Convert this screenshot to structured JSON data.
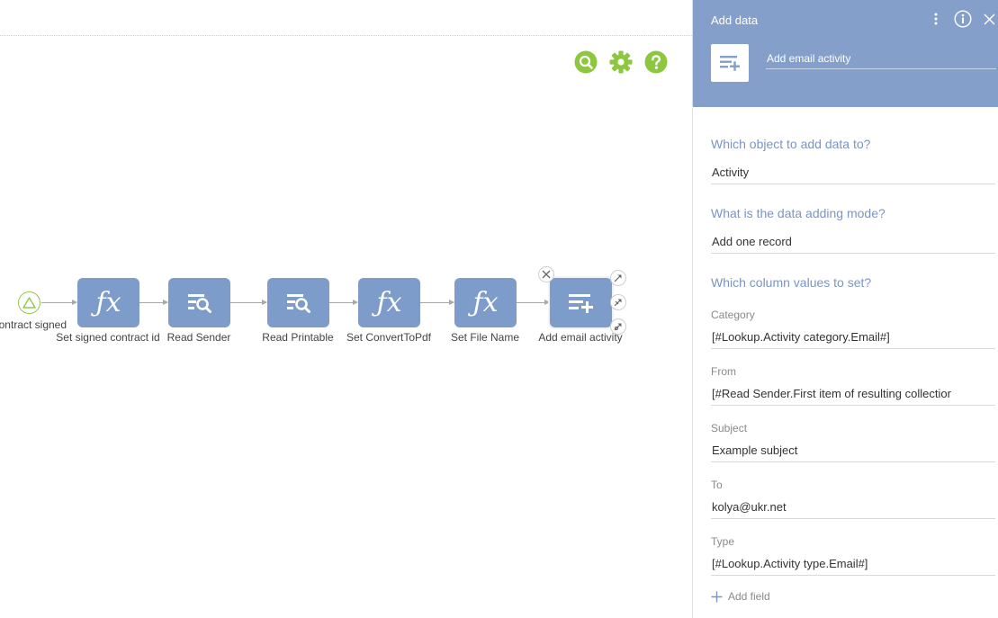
{
  "canvas": {
    "toolbar": {
      "search_icon": "search-icon",
      "settings_icon": "gear-icon",
      "help_icon": "help-icon"
    },
    "colors": {
      "toolbar_green": "#8dc63f",
      "node_blue": "#7e9cc9",
      "start_green": "#8fc84f"
    },
    "start_event": {
      "label": "Contract signed"
    },
    "nodes": [
      {
        "label": "Set signed contract id",
        "icon": "formula-icon"
      },
      {
        "label": "Read Sender",
        "icon": "read-data-icon"
      },
      {
        "label": "Read Printable",
        "icon": "read-data-icon"
      },
      {
        "label": "Set ConvertToPdf",
        "icon": "formula-icon"
      },
      {
        "label": "Set File Name",
        "icon": "formula-icon"
      },
      {
        "label": "Add email activity",
        "icon": "add-data-icon"
      }
    ]
  },
  "panel": {
    "title": "Add data",
    "header_color": "#849fc9",
    "element_name": "Add email activity",
    "q_object": "Which object to add data to?",
    "object_value": "Activity",
    "q_mode": "What is the data adding mode?",
    "mode_value": "Add one record",
    "q_columns": "Which column values to set?",
    "fields": [
      {
        "label": "Category",
        "value": "[#Lookup.Activity category.Email#]"
      },
      {
        "label": "From",
        "value": "[#Read Sender.First item of resulting collectior"
      },
      {
        "label": "Subject",
        "value": "Example subject"
      },
      {
        "label": "To",
        "value": "kolya@ukr.net"
      },
      {
        "label": "Type",
        "value": "[#Lookup.Activity type.Email#]"
      }
    ],
    "add_field_label": "Add field"
  }
}
